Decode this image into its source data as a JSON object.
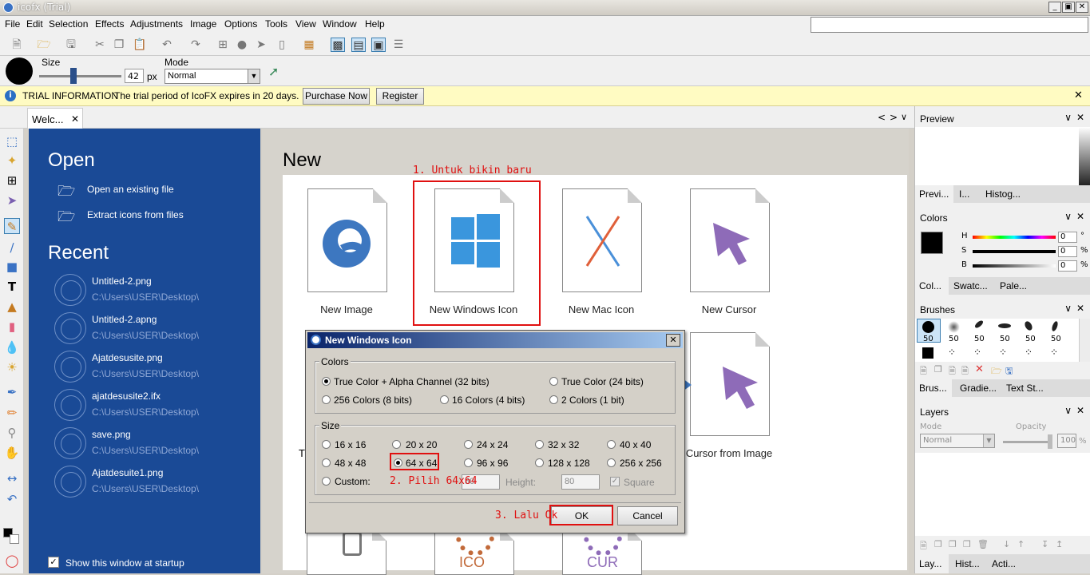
{
  "window": {
    "title": "icofx (Trial)",
    "min": "_",
    "restore": "▣",
    "close": "✕"
  },
  "menu": [
    "File",
    "Edit",
    "Selection",
    "Effects",
    "Adjustments",
    "Image",
    "Options",
    "Tools",
    "View",
    "Window",
    "Help"
  ],
  "options": {
    "size_label": "Size",
    "size_value": "42",
    "size_unit": "px",
    "mode_label": "Mode",
    "mode_value": "Normal"
  },
  "trial": {
    "heading": "TRIAL INFORMATION",
    "message": "The trial period of IcoFX expires in 20 days.",
    "purchase": "Purchase Now",
    "register": "Register",
    "close": "✕"
  },
  "tabs": {
    "welcome": "Welc...",
    "close": "✕",
    "nav_prev": "<",
    "nav_next": ">",
    "nav_menu": "∨"
  },
  "welcome": {
    "open_title": "Open",
    "open_items": [
      "Open an existing file",
      "Extract icons from files"
    ],
    "recent_title": "Recent",
    "recent": [
      {
        "name": "Untitled-2.png",
        "path": "C:\\Users\\USER\\Desktop\\"
      },
      {
        "name": "Untitled-2.apng",
        "path": "C:\\Users\\USER\\Desktop\\"
      },
      {
        "name": "Ajatdesusite.png",
        "path": "C:\\Users\\USER\\Desktop\\"
      },
      {
        "name": "ajatdesusite2.ifx",
        "path": "C:\\Users\\USER\\Desktop\\"
      },
      {
        "name": "save.png",
        "path": "C:\\Users\\USER\\Desktop\\"
      },
      {
        "name": "Ajatdesuite1.png",
        "path": "C:\\Users\\USER\\Desktop\\"
      }
    ],
    "startup": "Show this window at startup"
  },
  "new_section": {
    "title": "New",
    "cards": [
      "New Image",
      "New Windows Icon",
      "New Mac Icon",
      "New Cursor"
    ],
    "row2_left": "T",
    "row2_right": "Cursor from Image",
    "row3": [
      "ICO",
      "CUR"
    ]
  },
  "annotations": {
    "step1": "1. Untuk bikin baru",
    "step2": "2. Pilih 64x64",
    "step3": "3. Lalu Ok"
  },
  "dialog": {
    "title": "New Windows Icon",
    "close": "✕",
    "colors_label": "Colors",
    "colors": [
      "True Color + Alpha Channel (32 bits)",
      "True Color (24 bits)",
      "256 Colors (8 bits)",
      "16 Colors (4 bits)",
      "2 Colors (1 bit)"
    ],
    "size_label": "Size",
    "sizes": [
      "16 x 16",
      "20 x 20",
      "24 x 24",
      "32 x 32",
      "40 x 40",
      "48 x 48",
      "64 x 64",
      "96 x 96",
      "128 x 128",
      "256 x 256"
    ],
    "custom_label": "Custom:",
    "width_value": "80",
    "height_label": "Height:",
    "height_value": "80",
    "square_label": "Square",
    "ok": "OK",
    "cancel": "Cancel"
  },
  "right": {
    "preview_title": "Preview",
    "preview_tabs": [
      "Previ...",
      "I...",
      "Histog..."
    ],
    "colors_title": "Colors",
    "hsb": [
      "H",
      "S",
      "B"
    ],
    "hsb_values": [
      "0",
      "0",
      "0"
    ],
    "hsb_units": [
      "°",
      "%",
      "%"
    ],
    "colors_tabs": [
      "Col...",
      "Swatc...",
      "Pale..."
    ],
    "brushes_title": "Brushes",
    "brush_sizes": [
      "50",
      "50",
      "50",
      "50",
      "50",
      "50"
    ],
    "brushes_tabs": [
      "Brus...",
      "Gradie...",
      "Text St..."
    ],
    "layers_title": "Layers",
    "mode_label": "Mode",
    "mode_value": "Normal",
    "opacity_label": "Opacity",
    "opacity_value": "100",
    "opacity_unit": "%",
    "layers_tabs": [
      "Lay...",
      "Hist...",
      "Acti..."
    ]
  },
  "colors": {
    "accent_blue": "#1a4a96",
    "annotation_red": "#e01010",
    "trial_yellow": "#fffbc2",
    "win_blue": "#3a96dd",
    "cursor_purple": "#8e6bb8"
  }
}
